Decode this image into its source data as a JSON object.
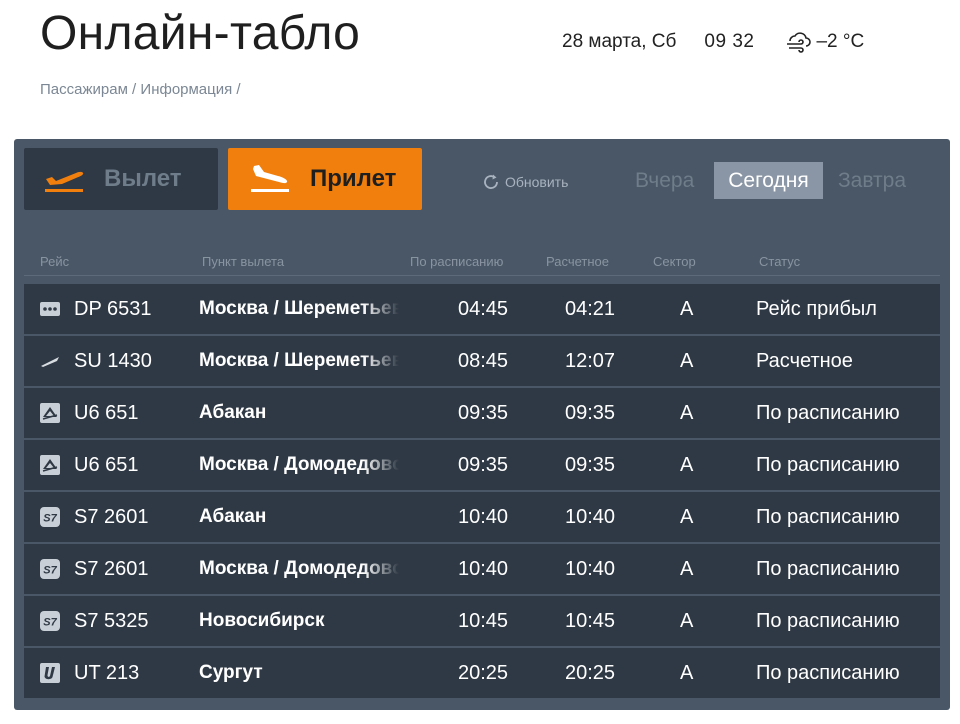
{
  "header": {
    "title": "Онлайн-табло",
    "date": "28 марта, Сб",
    "time": "09 32",
    "temperature": "–2 °C",
    "weather_icon": "wind-cloud-icon"
  },
  "breadcrumb": {
    "items": [
      "Пассажирам",
      "Информация"
    ],
    "separator": " / "
  },
  "tabs": {
    "departure_label": "Вылет",
    "arrival_label": "Прилет",
    "active": "arrival"
  },
  "refresh_label": "Обновить",
  "days": {
    "yesterday": "Вчера",
    "today": "Сегодня",
    "tomorrow": "Завтра",
    "active": "today"
  },
  "columns": {
    "flight": "Рейс",
    "origin": "Пункт вылета",
    "scheduled": "По расписанию",
    "estimated": "Расчетное",
    "sector": "Сектор",
    "status": "Статус"
  },
  "flights": [
    {
      "airline_icon": "dots-logo-icon",
      "flight": "DP 6531",
      "origin": "Москва / Шереметьево",
      "scheduled": "04:45",
      "estimated": "04:21",
      "sector": "A",
      "status": "Рейс прибыл"
    },
    {
      "airline_icon": "plane-logo-icon",
      "flight": "SU 1430",
      "origin": "Москва / Шереметьево",
      "scheduled": "08:45",
      "estimated": "12:07",
      "sector": "A",
      "status": "Расчетное"
    },
    {
      "airline_icon": "ural-logo-icon",
      "flight": "U6 651",
      "origin": "Абакан",
      "scheduled": "09:35",
      "estimated": "09:35",
      "sector": "A",
      "status": "По расписанию"
    },
    {
      "airline_icon": "ural-logo-icon",
      "flight": "U6 651",
      "origin": "Москва / Домодедово",
      "scheduled": "09:35",
      "estimated": "09:35",
      "sector": "A",
      "status": "По расписанию"
    },
    {
      "airline_icon": "s7-logo-icon",
      "flight": "S7 2601",
      "origin": "Абакан",
      "scheduled": "10:40",
      "estimated": "10:40",
      "sector": "A",
      "status": "По расписанию"
    },
    {
      "airline_icon": "s7-logo-icon",
      "flight": "S7 2601",
      "origin": "Москва / Домодедово",
      "scheduled": "10:40",
      "estimated": "10:40",
      "sector": "A",
      "status": "По расписанию"
    },
    {
      "airline_icon": "s7-logo-icon",
      "flight": "S7 5325",
      "origin": "Новосибирск",
      "scheduled": "10:45",
      "estimated": "10:45",
      "sector": "A",
      "status": "По расписанию"
    },
    {
      "airline_icon": "utair-logo-icon",
      "flight": "UT 213",
      "origin": "Сургут",
      "scheduled": "20:25",
      "estimated": "20:25",
      "sector": "A",
      "status": "По расписанию"
    }
  ],
  "colors": {
    "accent": "#f07f0e",
    "board_bg": "#4a5766",
    "row_bg": "#2f3945",
    "today_bg": "#8a96a5"
  }
}
